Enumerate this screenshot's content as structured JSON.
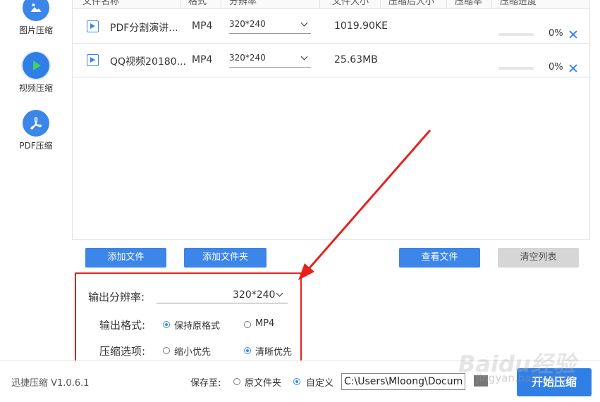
{
  "sidebar": {
    "items": [
      {
        "label": "图片压缩",
        "icon": "image-icon"
      },
      {
        "label": "视频压缩",
        "icon": "play-icon"
      },
      {
        "label": "PDF压缩",
        "icon": "pdf-icon"
      }
    ]
  },
  "table": {
    "headers": [
      "文件名称",
      "格式",
      "分辨率",
      "文件大小",
      "压缩后大小",
      "压缩率",
      "压缩进度"
    ],
    "rows": [
      {
        "name": "PDF分割演讲...",
        "format": "MP4",
        "resolution": "320*240",
        "size": "1019.90KE",
        "progress": 0,
        "progress_label": "0%"
      },
      {
        "name": "QQ视频20180...",
        "format": "MP4",
        "resolution": "320*240",
        "size": "25.63MB",
        "progress": 0,
        "progress_label": "0%"
      }
    ]
  },
  "buttons": {
    "add_file": "添加文件",
    "add_folder": "添加文件夹",
    "view_files": "查看文件",
    "clear_list": "清空列表"
  },
  "options": {
    "resolution_label": "输出分辨率:",
    "resolution_value": "320*240",
    "format_label": "输出格式:",
    "format_options": [
      "保持原格式",
      "MP4"
    ],
    "format_selected": "保持原格式",
    "compress_label": "压缩选项:",
    "compress_options": [
      "缩小优先",
      "清晰优先"
    ],
    "compress_selected": "清晰优先"
  },
  "footer": {
    "version": "迅捷压缩 V1.0.6.1",
    "save_to_label": "保存至:",
    "save_options": [
      "原文件夹",
      "自定义"
    ],
    "save_selected": "自定义",
    "path": "C:\\Users\\Mloong\\Docum",
    "start_button": "开始压缩"
  },
  "watermark": {
    "brand": "Baidu经验",
    "domain": "jingyan.baidu.com"
  },
  "colors": {
    "accent": "#3b86e8",
    "highlight": "#e8211c"
  }
}
